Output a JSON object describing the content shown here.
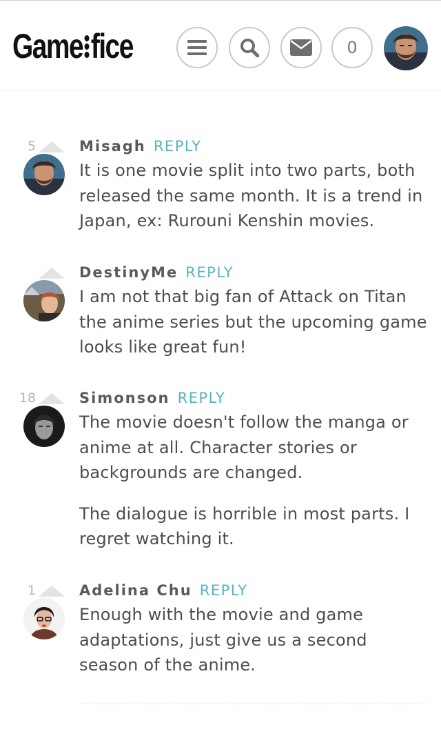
{
  "header": {
    "logo_left": "Game",
    "logo_right": "fice",
    "notification_count": "0"
  },
  "icons": {
    "menu": "hamburger-icon",
    "search": "search-icon",
    "mail": "envelope-icon"
  },
  "comments": [
    {
      "votes": "5",
      "author": "Misagh",
      "reply": "REPLY",
      "paragraphs": [
        "It is one movie split into two parts, both released the same month. It is a trend in Japan, ex: Rurouni Kenshin movies."
      ]
    },
    {
      "votes": "",
      "author": "DestinyMe",
      "reply": "REPLY",
      "paragraphs": [
        "I am not that big fan of Attack on Titan the anime series but the upcoming game looks like great fun!"
      ]
    },
    {
      "votes": "18",
      "author": "Simonson",
      "reply": "REPLY",
      "paragraphs": [
        "The movie doesn't follow the manga or anime at all. Character stories or backgrounds are changed.",
        "The dialogue is horrible in most parts. I regret watching it."
      ]
    },
    {
      "votes": "1",
      "author": "Adelina Chu",
      "reply": "REPLY",
      "paragraphs": [
        "Enough with the movie and game adaptations, just give us a second season of the anime."
      ]
    }
  ],
  "colors": {
    "reply": "#58b3bd",
    "text": "#4d4d4d",
    "button_border": "#c9c9c9"
  }
}
